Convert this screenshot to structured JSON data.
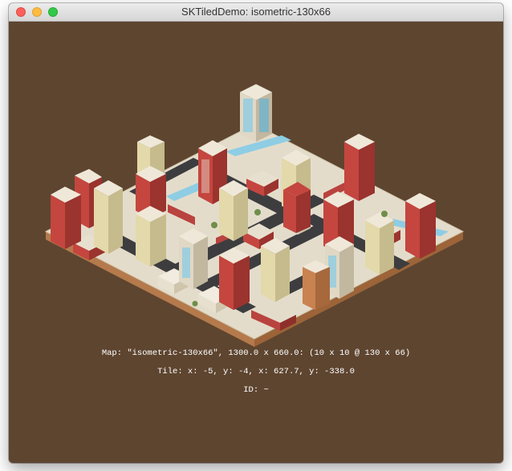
{
  "window": {
    "title": "SKTiledDemo: isometric-130x66"
  },
  "hud": {
    "map_info": "Map: \"isometric-130x66\", 1300.0 x 660.0: (10 x 10 @ 130 x 66)",
    "tile_info": "Tile: x: -5, y: -4, x: 627.7, y: -338.0",
    "id_info": "ID: ~"
  },
  "colors": {
    "background": "#5e4530",
    "road": "#3d3d3f",
    "ground": "#e4dccb",
    "water": "#8ecde4"
  }
}
